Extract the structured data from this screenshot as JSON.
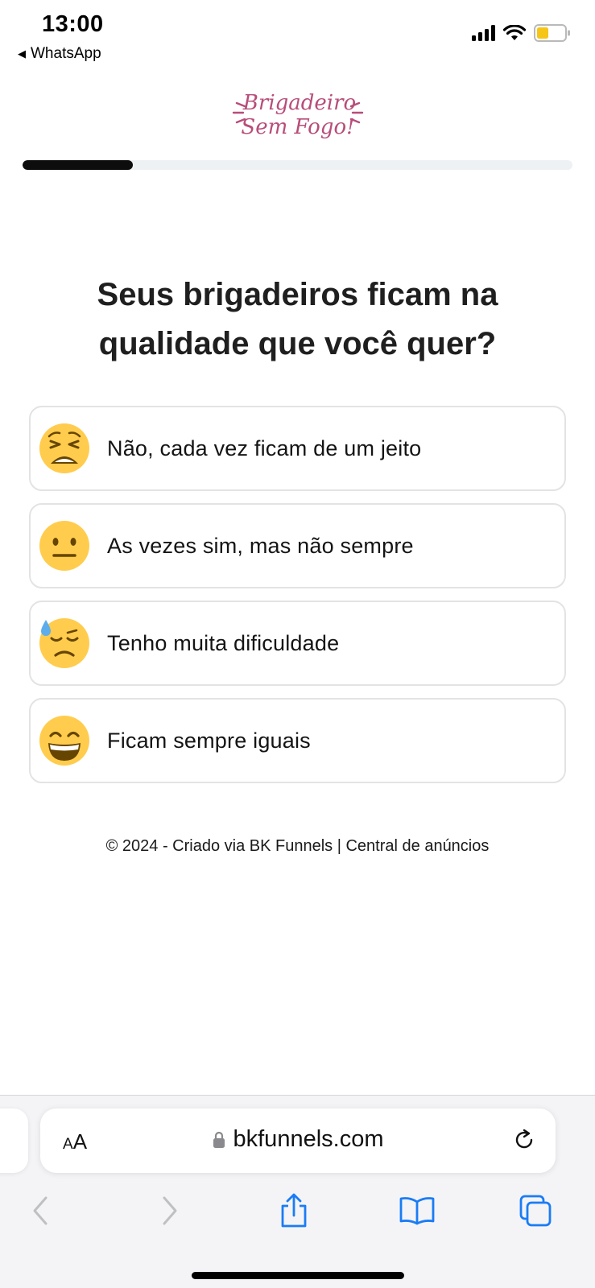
{
  "status_bar": {
    "time": "13:00",
    "back_app": "WhatsApp",
    "battery_color": "#f5c518"
  },
  "header": {
    "logo_line1": "Brigadeiro",
    "logo_line2": "Sem Fogo!",
    "logo_color": "#b84d7a",
    "progress_fraction": 0.2
  },
  "question": {
    "text": "Seus brigadeiros ficam na qualidade que você quer?"
  },
  "options": [
    {
      "icon": "weary-face-icon",
      "label": "Não, cada vez ficam de um jeito"
    },
    {
      "icon": "neutral-face-icon",
      "label": "As vezes sim, mas não sempre"
    },
    {
      "icon": "downcast-sweat-face-icon",
      "label": "Tenho muita dificuldade"
    },
    {
      "icon": "grinning-face-icon",
      "label": "Ficam sempre iguais"
    }
  ],
  "footer": {
    "copyright": "© 2024 - Criado via BK Funnels",
    "separator": "|",
    "link": "Central de anúncios"
  },
  "browser": {
    "text_size_label_small": "A",
    "text_size_label_large": "A",
    "url": "bkfunnels.com",
    "accent_color": "#1a7cf5"
  }
}
